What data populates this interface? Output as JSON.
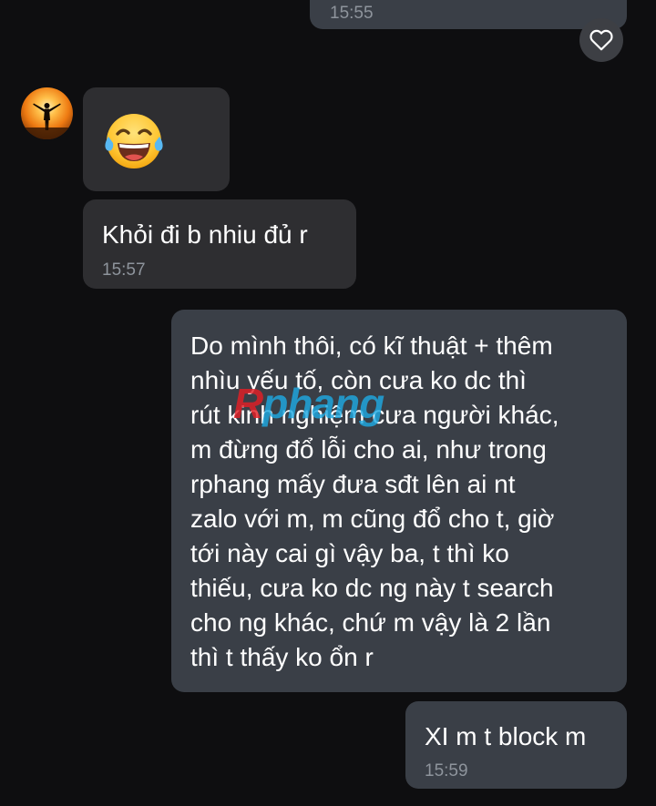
{
  "messages": {
    "top_outgoing": {
      "time": "15:55"
    },
    "incoming_emoji": {
      "emoji": "face-with-tears-of-joy"
    },
    "incoming_text": {
      "text": "Khỏi đi b nhiu đủ r",
      "time": "15:57"
    },
    "outgoing_long": {
      "lines": [
        "Do mình thôi, có kĩ thuật + thêm",
        "nhìu yếu tố, còn cưa ko dc thì",
        "rút kinh nghiệm cưa người khác,",
        "m đừng đổ lỗi cho ai, như trong",
        "rphang mấy đưa sđt lên ai nt",
        "zalo với m, m cũng đổ cho t, giờ",
        "tới này cai gì vậy ba, t thì ko",
        "thiếu, cưa ko dc ng này t search",
        "cho ng khác, chứ m vậy là 2 lần",
        "thì t thấy ko ổn r"
      ]
    },
    "outgoing_last": {
      "text": "XI m t block m",
      "time": "15:59"
    }
  },
  "watermark": {
    "first": "R",
    "rest": "phang"
  },
  "icons": {
    "heart": "heart-outline-icon",
    "avatar": "sunset-silhouette-avatar"
  },
  "colors": {
    "background": "#0e0e10",
    "outgoing_bubble": "#3a3f47",
    "incoming_bubble": "#2e2e31",
    "timestamp": "#8e949c",
    "watermark_red": "#e31f26",
    "watermark_blue": "#1fa9e1"
  }
}
